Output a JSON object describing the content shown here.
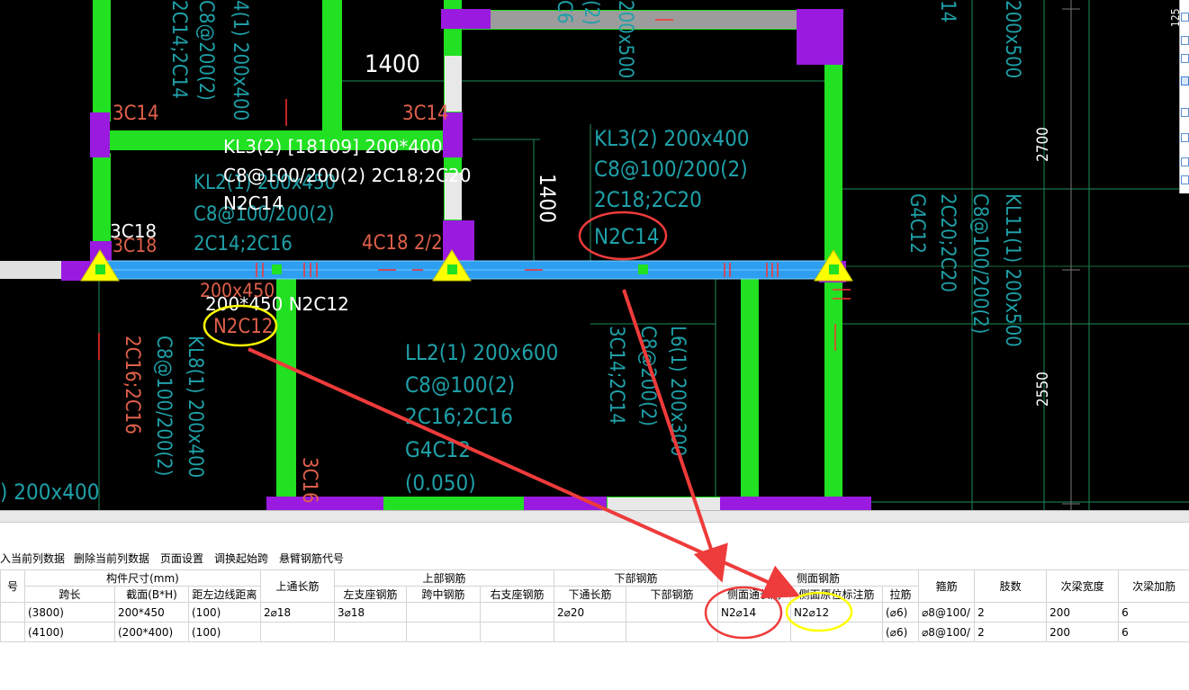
{
  "cad": {
    "dims": {
      "d1400_top": "1400",
      "d1400_vert": "1400",
      "d2700": "2700",
      "d2550": "2550",
      "edge_num": "125"
    },
    "labels": {
      "c14_left": "3C14",
      "c14_mid": "3C14",
      "c18_white": "3C18",
      "c18_red": "3C18",
      "c18_mid": "4C18 2/2",
      "c16_bottom": "3C16",
      "c16_left": "2C16;2C16",
      "top_a": "C8@200(2)",
      "top_b": "2C14;2C14",
      "top_c": "4(1) 200x400",
      "top_d": "2C14",
      "top_e": "C6",
      "top_f": "(2)",
      "top_g": "200x500",
      "top_h": "200x500",
      "top_i": "14"
    },
    "white_block": {
      "l1": "KL3(2) [18109] 200*400",
      "l2": "C8@100/200(2) 2C18;2C20",
      "l3": "N2C14"
    },
    "kl2": {
      "l1": "KL2(1) 200x450",
      "l2": "C8@100/200(2)",
      "l3": "2C14;2C16"
    },
    "kl3_right": {
      "l1": "KL3(2) 200x400",
      "l2": "C8@100/200(2)",
      "l3": "2C18;2C20",
      "l4": "N2C14"
    },
    "beam_white": {
      "l1": "200*450 N2C12",
      "l2": "200x450",
      "l3": "N2C12"
    },
    "kl8": {
      "l1": "C8@100/200(2)",
      "l2": "KL8(1) 200x400"
    },
    "ll2": {
      "l1": "LL2(1) 200x600",
      "l2": "C8@100(2)",
      "l3": "2C16;2C16",
      "l4": "G4C12",
      "l5": "(0.050)"
    },
    "l6": {
      "l1": "3C14;2C14",
      "l2": "C8@200(2)",
      "l3": "L6(1) 200x300"
    },
    "kl11": {
      "l1": "G4C12",
      "l2": "2C20;2C20",
      "l3": "C8@100/200(2)",
      "l4": "KL11(1) 200x500"
    },
    "bottom_left": ") 200x400"
  },
  "toolbar": {
    "insert": "入当前列数据",
    "delete": "删除当前列数据",
    "page_setup": "页面设置",
    "swap_span": "调换起始跨",
    "cantilever": "悬臂钢筋代号"
  },
  "table": {
    "group_headers": {
      "num": "号",
      "size": "构件尺寸(mm)",
      "top_through": "上通长筋",
      "upper": "上部钢筋",
      "lower": "下部钢筋",
      "side": "侧面钢筋",
      "stirrup": "箍筋",
      "legs": "肢数",
      "sec_width": "次梁宽度",
      "sec_add": "次梁加筋"
    },
    "sub_headers": {
      "span": "跨长",
      "section": "截面(B*H)",
      "offset": "距左边线距离",
      "left_seat": "左支座钢筋",
      "mid_span": "跨中钢筋",
      "right_seat": "右支座钢筋",
      "bottom_through": "下通长筋",
      "bottom_bar": "下部钢筋",
      "side_through": "侧面通长筋",
      "side_orig": "侧面原位标注筋",
      "tie": "拉筋"
    },
    "rows": [
      {
        "span": "(3800)",
        "section": "200*450",
        "offset": "(100)",
        "top_through": "2⌀18",
        "left_seat": "3⌀18",
        "mid_span": "",
        "right_seat": "",
        "bottom_through": "2⌀20",
        "bottom_bar": "",
        "side_through": "N2⌀14",
        "side_orig": "N2⌀12",
        "tie": "(⌀6)",
        "stirrup": "⌀8@100/",
        "legs": "2",
        "sec_width": "200",
        "sec_add": "6"
      },
      {
        "span": "(4100)",
        "section": "(200*400)",
        "offset": "(100)",
        "top_through": "",
        "left_seat": "",
        "mid_span": "",
        "right_seat": "",
        "bottom_through": "",
        "bottom_bar": "",
        "side_through": "",
        "side_orig": "",
        "tie": "(⌀6)",
        "stirrup": "⌀8@100/",
        "legs": "2",
        "sec_width": "200",
        "sec_add": "6"
      }
    ]
  },
  "colors": {
    "beam_green": "#22e022",
    "column_purple": "#9a1adf",
    "selected_beam": "#2e9ff0",
    "cad_cyan": "#1fa0a8",
    "cad_red": "#e0604a",
    "mark_red": "#ee3b3b",
    "mark_yellow": "#ffff00"
  }
}
